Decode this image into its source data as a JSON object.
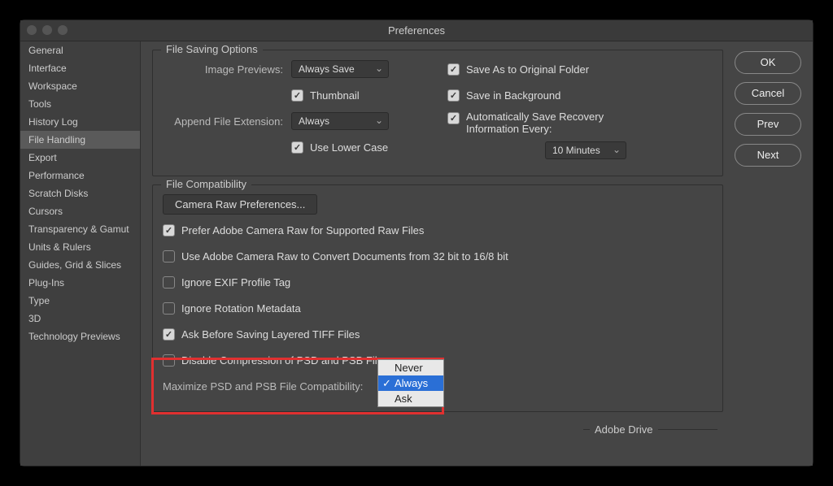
{
  "window": {
    "title": "Preferences"
  },
  "buttons": {
    "ok": "OK",
    "cancel": "Cancel",
    "prev": "Prev",
    "next": "Next"
  },
  "sidebar": {
    "items": [
      "General",
      "Interface",
      "Workspace",
      "Tools",
      "History Log",
      "File Handling",
      "Export",
      "Performance",
      "Scratch Disks",
      "Cursors",
      "Transparency & Gamut",
      "Units & Rulers",
      "Guides, Grid & Slices",
      "Plug-Ins",
      "Type",
      "3D",
      "Technology Previews"
    ],
    "active_index": 5
  },
  "file_saving": {
    "group_title": "File Saving Options",
    "image_previews_label": "Image Previews:",
    "image_previews_value": "Always Save",
    "thumbnail": "Thumbnail",
    "append_ext_label": "Append File Extension:",
    "append_ext_value": "Always",
    "lower_case": "Use Lower Case",
    "save_as_original": "Save As to Original Folder",
    "save_bg": "Save in Background",
    "auto_save": "Automatically Save Recovery Information Every:",
    "auto_save_value": "10 Minutes"
  },
  "file_compat": {
    "group_title": "File Compatibility",
    "camera_raw_btn": "Camera Raw Preferences...",
    "prefer_acr": "Prefer Adobe Camera Raw for Supported Raw Files",
    "use_acr_32": "Use Adobe Camera Raw to Convert Documents from 32 bit to 16/8 bit",
    "ignore_exif": "Ignore EXIF Profile Tag",
    "ignore_rotation": "Ignore Rotation Metadata",
    "ask_tiff": "Ask Before Saving Layered TIFF Files",
    "disable_compress": "Disable Compression of PSD and PSB Files",
    "maximize_label": "Maximize PSD and PSB File Compatibility:",
    "maximize_options": [
      "Never",
      "Always",
      "Ask"
    ],
    "maximize_selected_index": 1
  },
  "adobe_drive": {
    "title": "Adobe Drive"
  }
}
